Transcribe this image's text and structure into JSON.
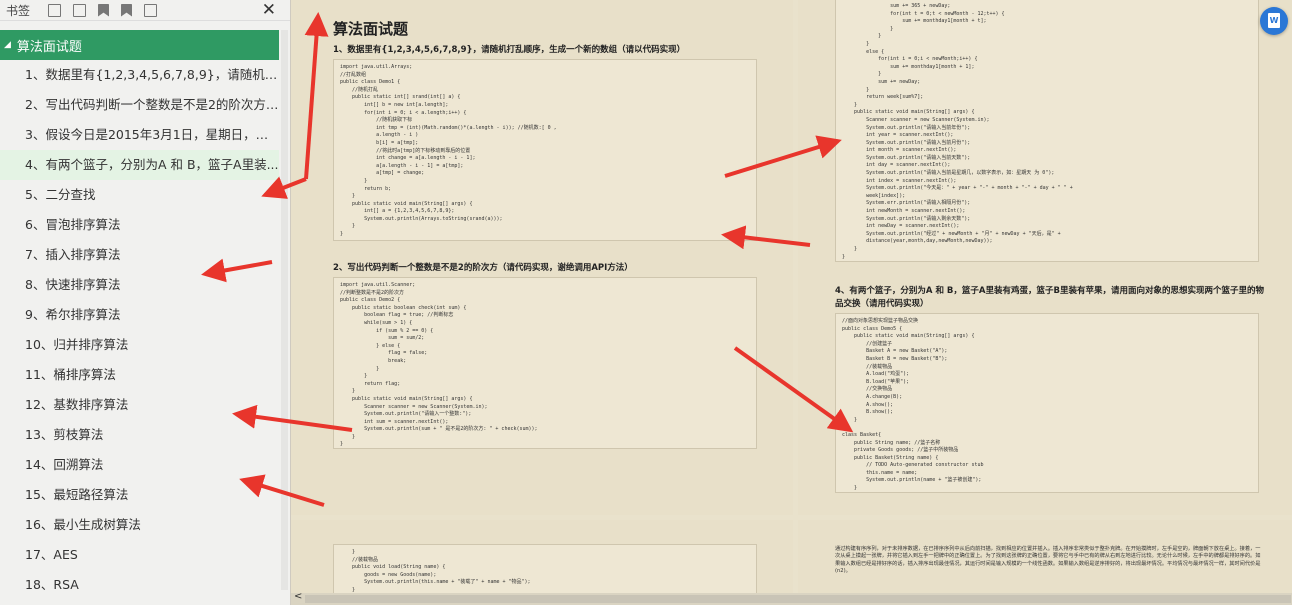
{
  "sidebar": {
    "tab_label": "书签",
    "close_glyph": "✕",
    "root": {
      "label": "算法面试题",
      "expander": "◢"
    },
    "items": [
      "1、数据里有{1,2,3,4,5,6,7,8,9}，请随机打乱...",
      "2、写出代码判断一个整数是不是2的阶次方（...",
      "3、假设今日是2015年3月1日，星期日，请算...",
      "4、有两个篮子，分别为A 和 B，篮子A里装...",
      "5、二分查找",
      "6、冒泡排序算法",
      "7、插入排序算法",
      "8、快速排序算法",
      "9、希尔排序算法",
      "10、归并排序算法",
      "11、桶排序算法",
      "12、基数排序算法",
      "13、剪枝算法",
      "14、回溯算法",
      "15、最短路径算法",
      "16、最小生成树算法",
      "17、AES",
      "18、RSA"
    ],
    "selected_index": 3
  },
  "doc": {
    "title": "算法面试题",
    "q1": "1、数据里有{1,2,3,4,5,6,7,8,9}，请随机打乱顺序，生成一个新的数组（请以代码实现）",
    "q2": "2、写出代码判断一个整数是不是2的阶次方（请代码实现，谢绝调用API方法）",
    "q4": "4、有两个篮子，分别为A 和 B，篮子A里装有鸡蛋，篮子B里装有苹果，请用面向对象的思想实现两个篮子里的物品交换（请用代码实现）",
    "code1": "import java.util.Arrays;\n//打乱数组\npublic class Demo1 {\n    //随机打乱\n    public static int[] srand(int[] a) {\n        int[] b = new int[a.length];\n        for(int i = 0; i < a.length;i++) {\n            //随机获取下标\n            int tmp = (int)(Math.random()*(a.length - i)); //随机数:[ 0 ,\n            a.length - i )\n            b[i] = a[tmp];\n            //将此时a[tmp]的下标移动到靠后的位置\n            int change = a[a.length - i - 1];\n            a[a.length - i - 1] = a[tmp];\n            a[tmp] = change;\n        }\n        return b;\n    }\n    public static void main(String[] args) {\n        int[] a = {1,2,3,4,5,6,7,8,9};\n        System.out.println(Arrays.toString(srand(a)));\n    }\n}",
    "code2": "import java.util.Scanner;\n//判断整数是不是2的阶次方\npublic class Demo2 {\n    public static boolean check(int sum) {\n        boolean flag = true; //判断标志\n        while(sum > 1) {\n            if (sum % 2 == 0) {\n                sum = sum/2;\n            } else {\n                flag = false;\n                break;\n            }\n        }\n        return flag;\n    }\n    public static void main(String[] args) {\n        Scanner scanner = new Scanner(System.in);\n        System.out.println(\"请输入一个整数:\");\n        int sum = scanner.nextInt();\n        System.out.println(sum + \" 是不是2的阶次方: \" + check(sum));\n    }\n}",
    "code3": "                sum += 365 + newDay;\n                for(int t = 0;t < newMonth - 12;t++) {\n                    sum += monthday1[month + t];\n                }\n            }\n        }\n        else {\n            for(int i = 0;i < newMonth;i++) {\n                sum += monthday1[month + 1];\n            }\n            sum += newDay;\n        }\n        return week[sum%7];\n    }\n    public static void main(String[] args) {\n        Scanner scanner = new Scanner(System.in);\n        System.out.println(\"请输入当前年份\");\n        int year = scanner.nextInt();\n        System.out.println(\"请输入当前月份\");\n        int month = scanner.nextInt();\n        System.out.println(\"请输入当前天数\");\n        int day = scanner.nextInt();\n        System.out.println(\"请输入当前是星期几，以数字表示，如：星期天 为 0\");\n        int index = scanner.nextInt();\n        System.out.println(\"今天是：\" + year + \"-\" + month + \"-\" + day + \" \" +\n        week[index]);\n        System.err.println(\"请输入相隔月份\");\n        int newMonth = scanner.nextInt();\n        System.out.println(\"请输入剩余天数\");\n        int newDay = scanner.nextInt();\n        System.out.println(\"经过\" + newMonth + \"月\" + newDay + \"天后，是\" +\n        distance(year,month,day,newMonth,newDay));\n    }\n}",
    "code4": "//面向对象思想实现篮子物品交换\npublic class Demo5 {\n    public static void main(String[] args) {\n        //创建篮子\n        Basket A = new Basket(\"A\");\n        Basket B = new Basket(\"B\");\n        //装载物品\n        A.load(\"鸡蛋\");\n        B.load(\"苹果\");\n        //交换物品\n        A.change(B);\n        A.show();\n        B.show();\n    }\n}\nclass Basket{\n    public String name; //篮子名称\n    private Goods goods; //篮子中所装物品\n    public Basket(String name) {\n        // TODO Auto-generated constructor stub\n        this.name = name;\n        System.out.println(name + \"篮子被创建\");\n    }",
    "code5": "    }\n    //装载物品\n    public void load(String name) {\n        goods = new Goods(name);\n        System.out.println(this.name + \"装载了\" + name + \"物品\");\n    }",
    "para": "通过构建有序序列，对于未排序数据，在已排序序列中从后向前扫描，找到相应的位置并插入。插入排序非常类似于整扑克牌。在开始摸牌时，左手是空的，牌面朝下放在桌上。接着，一次从桌上摸起一张牌，并将它插入到左手一把牌中的正确位置上。为了找到这张牌的正确位置，要将它与手中已有的牌从右到左地进行比较。无论什么时候，左手中的牌都是排好序的。如果输入数组已经是排好序的话，插入排序出现最佳情况，其运行时间是输入规模的一个线性函数。如果输入数组是逆序排好的，将出现最坏情况。平均情况与最坏情况一样，其时间代价是(n2)。"
  },
  "colors": {
    "accent": "#2f9a63",
    "arrow": "#e8352c",
    "fab": "#2a77d6"
  },
  "icons": [
    "add-bookmark-icon",
    "expand-all-icon",
    "collapse-all-icon",
    "bookmark-icon",
    "bookmark-outline-icon",
    "trash-icon",
    "close-icon",
    "word-convert-icon",
    "arrow-left-icon"
  ],
  "fab": {
    "label": "W"
  },
  "hscroll": {
    "left_glyph": "<"
  }
}
